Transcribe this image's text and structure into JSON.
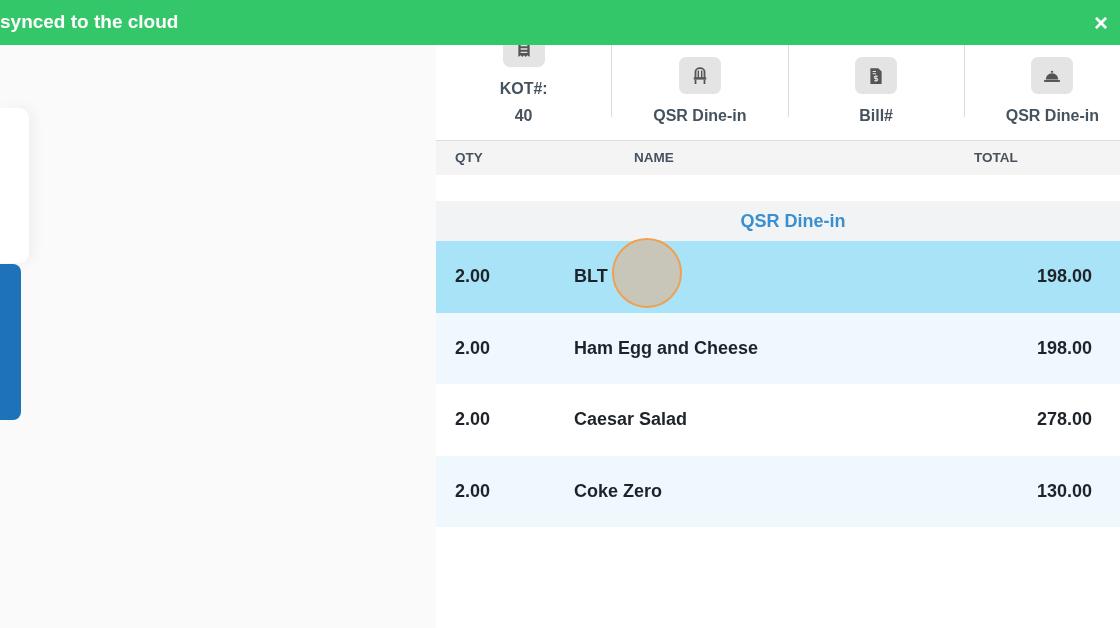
{
  "banner": {
    "message": "synced to the cloud",
    "close": "×"
  },
  "order_info": [
    {
      "label": "KOT#:",
      "value": "40"
    },
    {
      "label": "QSR Dine-in"
    },
    {
      "label": "Bill#"
    },
    {
      "label": "QSR Dine-in"
    }
  ],
  "table": {
    "columns": [
      "QTY",
      "NAME",
      "TOTAL"
    ],
    "group": "QSR Dine-in",
    "rows": [
      {
        "qty": "2.00",
        "name": "BLT",
        "total": "198.00",
        "selected": true
      },
      {
        "qty": "2.00",
        "name": "Ham Egg and Cheese",
        "total": "198.00",
        "selected": false
      },
      {
        "qty": "2.00",
        "name": "Caesar Salad",
        "total": "278.00",
        "selected": false
      },
      {
        "qty": "2.00",
        "name": "Coke Zero",
        "total": "130.00",
        "selected": false
      }
    ]
  }
}
